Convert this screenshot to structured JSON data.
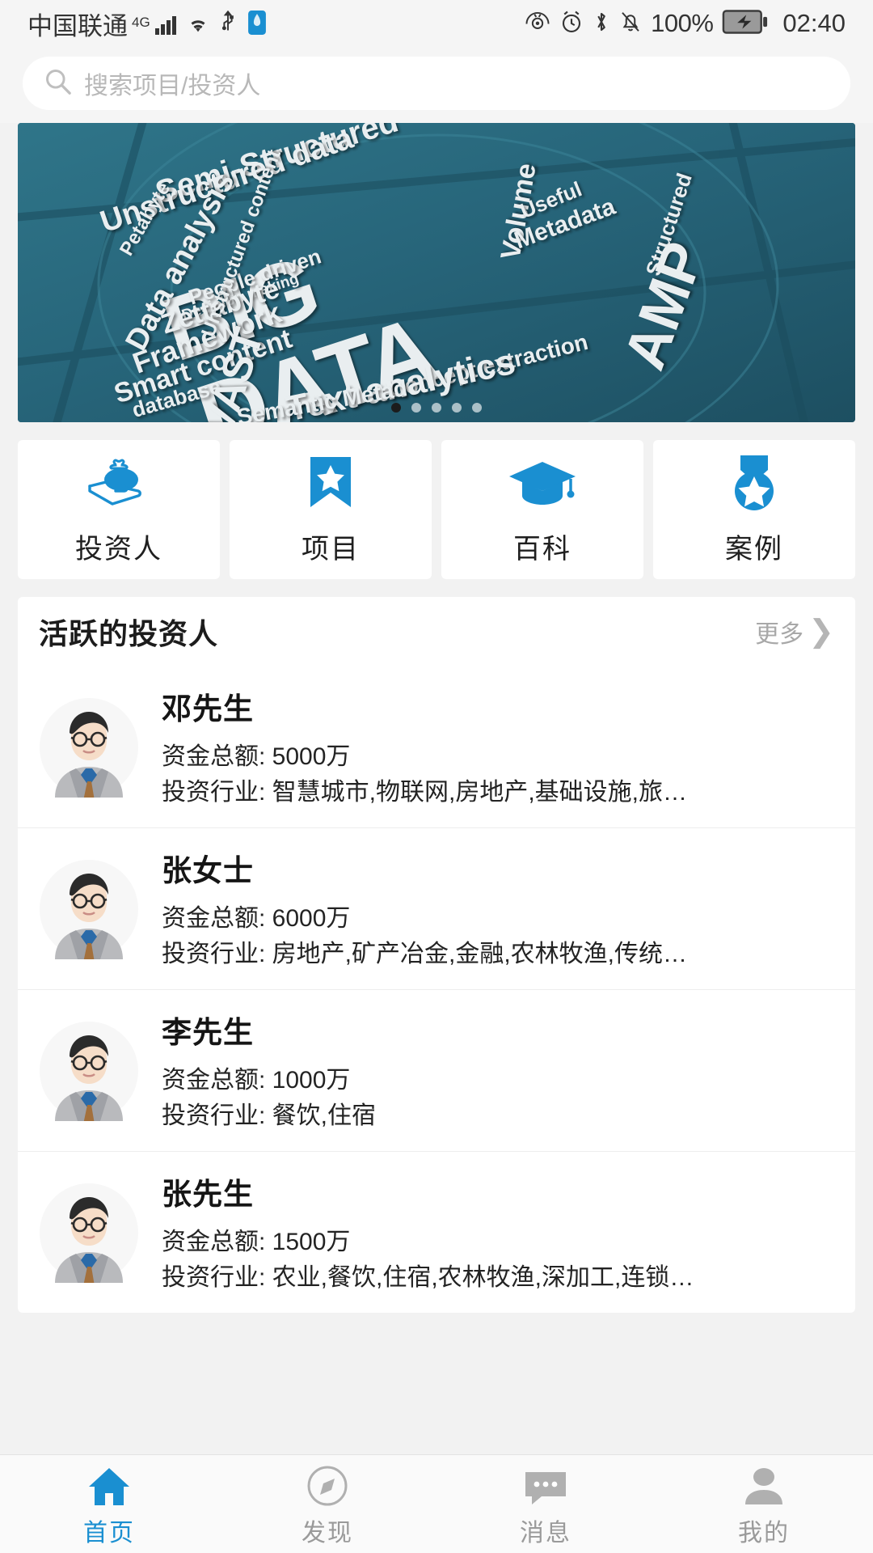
{
  "status_bar": {
    "carrier": "中国联通",
    "network": "4G",
    "battery_percent": "100%",
    "time": "02:40",
    "icons": [
      "signal-bars-icon",
      "wifi-icon",
      "usb-icon",
      "sim-card-icon",
      "eye-icon",
      "alarm-clock-icon",
      "bluetooth-icon",
      "mute-bell-icon",
      "battery-charging-icon"
    ]
  },
  "search": {
    "placeholder": "搜索项目/投资人",
    "icon": "search-icon"
  },
  "banner": {
    "alt": "BIG DATA word cloud",
    "words": [
      "BIG",
      "DATA",
      "Semi-Structured",
      "Unstructured data",
      "Volume",
      "Useful",
      "Metadata",
      "Structured",
      "Data analysis",
      "Petabyte",
      "People driven",
      "Decision making",
      "Zettabyte",
      "Framework",
      "Unstructured content",
      "Smart content",
      "database",
      "VAST",
      "Concept extraction",
      "Text analytics",
      "Semantic Metad",
      "AMP"
    ],
    "dots_total": 5,
    "dots_active_index": 0
  },
  "categories": [
    {
      "label": "投资人",
      "icon": "money-bag-on-hand-icon"
    },
    {
      "label": "项目",
      "icon": "bookmark-star-icon"
    },
    {
      "label": "百科",
      "icon": "graduation-cap-icon"
    },
    {
      "label": "案例",
      "icon": "medal-star-icon"
    }
  ],
  "section": {
    "title": "活跃的投资人",
    "more_label": "更多",
    "more_icon": "chevron-right-icon"
  },
  "investors": [
    {
      "avatar": "man-with-glasses-avatar",
      "name": "邓先生",
      "amount_line": "资金总额: 5000万",
      "industry_line": "投资行业: 智慧城市,物联网,房地产,基础设施,旅…"
    },
    {
      "avatar": "man-with-glasses-avatar",
      "name": "张女士",
      "amount_line": "资金总额: 6000万",
      "industry_line": "投资行业: 房地产,矿产冶金,金融,农林牧渔,传统…"
    },
    {
      "avatar": "man-with-glasses-avatar",
      "name": "李先生",
      "amount_line": "资金总额: 1000万",
      "industry_line": "投资行业: 餐饮,住宿"
    },
    {
      "avatar": "man-with-glasses-avatar",
      "name": "张先生",
      "amount_line": "资金总额: 1500万",
      "industry_line": "投资行业: 农业,餐饮,住宿,农林牧渔,深加工,连锁…"
    }
  ],
  "tabbar": [
    {
      "label": "首页",
      "icon": "home-icon",
      "active": true
    },
    {
      "label": "发现",
      "icon": "compass-icon",
      "active": false
    },
    {
      "label": "消息",
      "icon": "chat-bubble-icon",
      "active": false
    },
    {
      "label": "我的",
      "icon": "person-icon",
      "active": false
    }
  ],
  "colors": {
    "accent": "#1a8fd1",
    "page_bg": "#f2f2f2",
    "card_bg": "#ffffff",
    "banner_bg": "#2b6d80",
    "muted_text": "#a8a8a8"
  }
}
